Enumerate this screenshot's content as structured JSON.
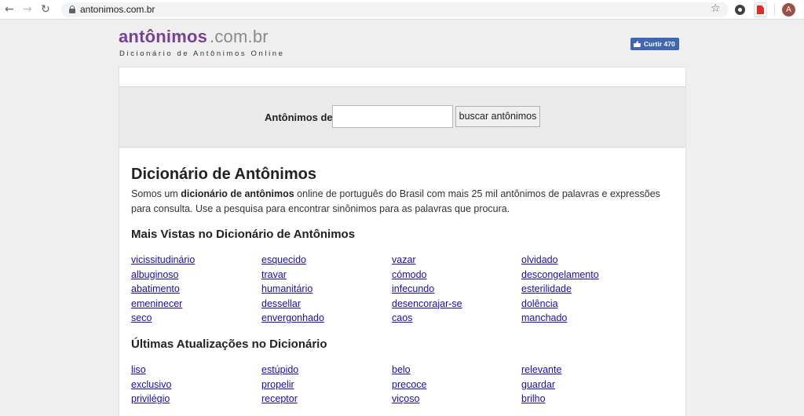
{
  "browser": {
    "url": "antonimos.com.br",
    "avatar_letter": "A"
  },
  "site": {
    "logo_name": "antônimos",
    "logo_domain": ".com.br",
    "tagline": "Dicionário de Antônimos Online",
    "like_label": "Curtir 470"
  },
  "search": {
    "label": "Antônimos de",
    "value": "",
    "button_label": "buscar antônimos"
  },
  "main": {
    "title": "Dicionário de Antônimos",
    "intro_before": "Somos um ",
    "intro_bold": "dicionário de antônimos",
    "intro_after": " online de português do Brasil com mais 25 mil antônimos de palavras e expressões para consulta. Use a pesquisa para encontrar sinônimos para as palavras que procura."
  },
  "most_viewed": {
    "title": "Mais Vistas no Dicionário de Antônimos",
    "rows": [
      [
        "vicissitudinário",
        "esquecido",
        "vazar",
        "olvidado"
      ],
      [
        "albuginoso",
        "travar",
        "cómodo",
        "descongelamento"
      ],
      [
        "abatimento",
        "humanitário",
        "infecundo",
        "esterilidade"
      ],
      [
        "emeninecer",
        "dessellar",
        "desencorajar-se",
        "dolência"
      ],
      [
        "seco",
        "envergonhado",
        "caos",
        "manchado"
      ]
    ]
  },
  "latest": {
    "title": "Últimas Atualizações no Dicionário",
    "rows": [
      [
        "liso",
        "estúpido",
        "belo",
        "relevante"
      ],
      [
        "exclusivo",
        "propelir",
        "precoce",
        "guardar"
      ],
      [
        "privilégio",
        "receptor",
        "viçoso",
        "brilho"
      ]
    ]
  }
}
